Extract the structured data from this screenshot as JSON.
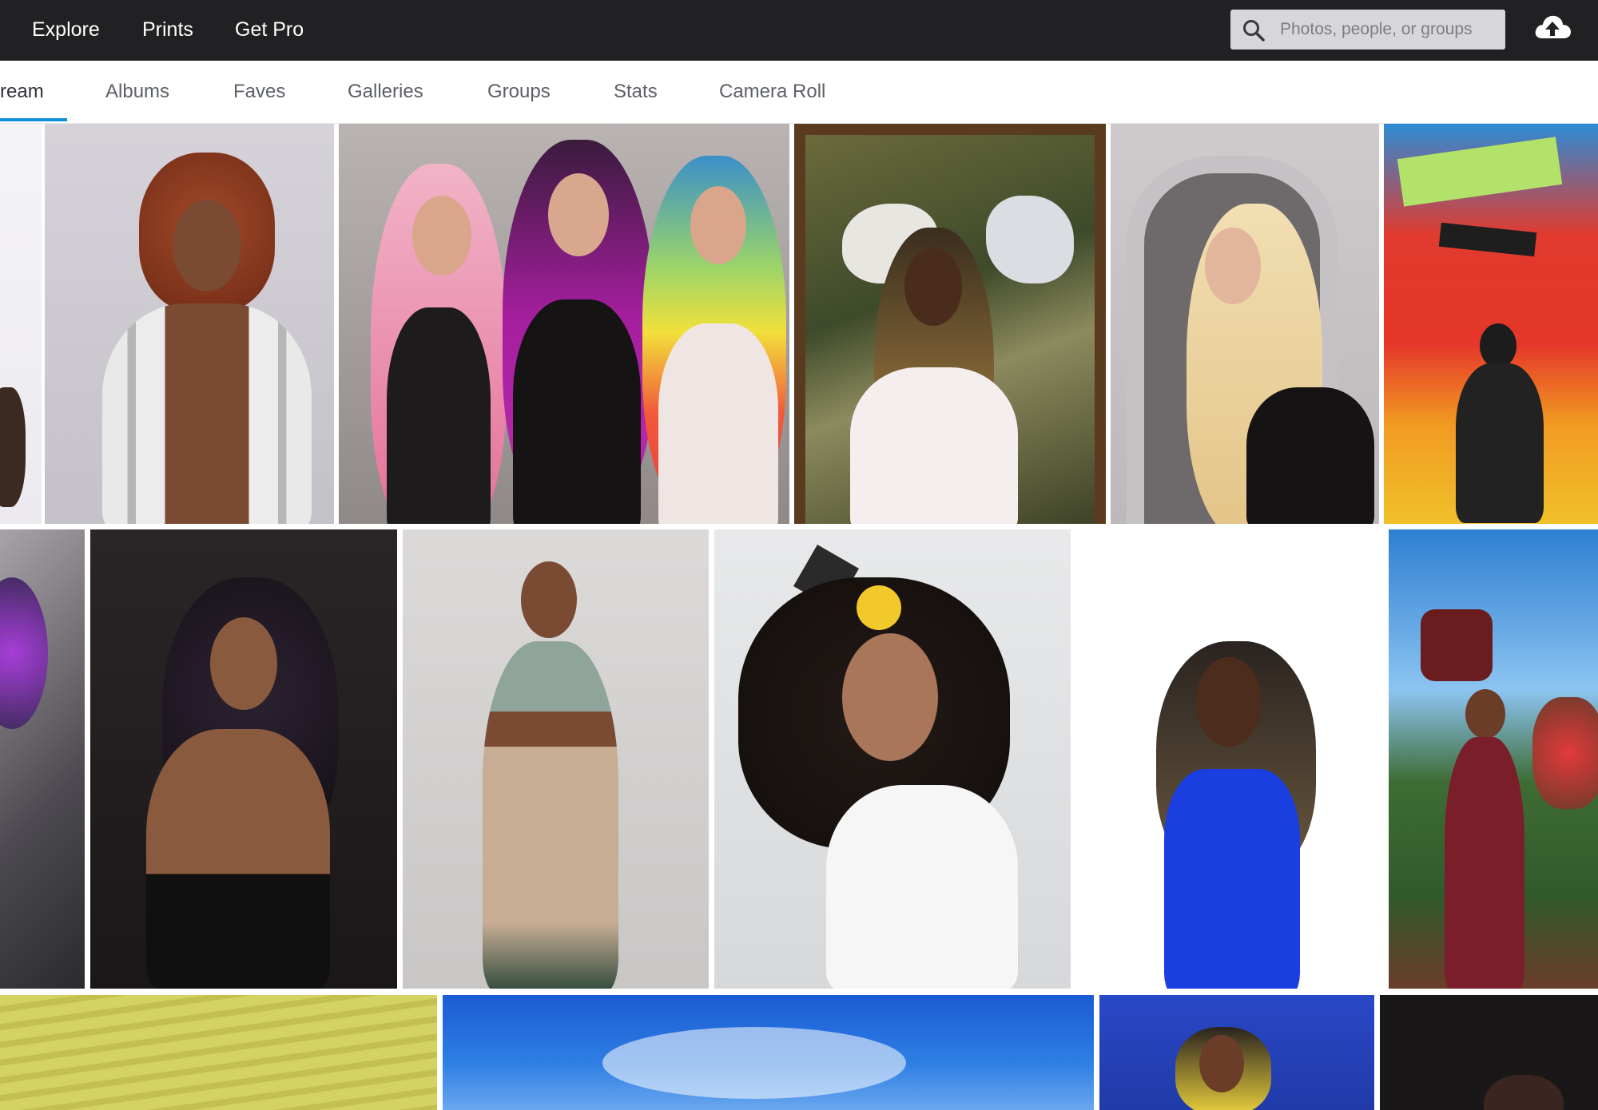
{
  "topbar": {
    "links": {
      "explore": "Explore",
      "prints": "Prints",
      "get_pro": "Get Pro"
    },
    "search": {
      "placeholder": "Photos, people, or groups",
      "icon": "search-icon"
    },
    "upload_icon": "cloud-upload-icon",
    "background": "#212124"
  },
  "subnav": {
    "tabs": {
      "photostream": "ream",
      "albums": "Albums",
      "faves": "Faves",
      "galleries": "Galleries",
      "groups": "Groups",
      "stats": "Stats",
      "camera_roll": "Camera Roll"
    },
    "active_tab": "photostream",
    "accent": "#128fdc"
  },
  "photo_grid": {
    "rows": 3,
    "photo_count": 17
  }
}
